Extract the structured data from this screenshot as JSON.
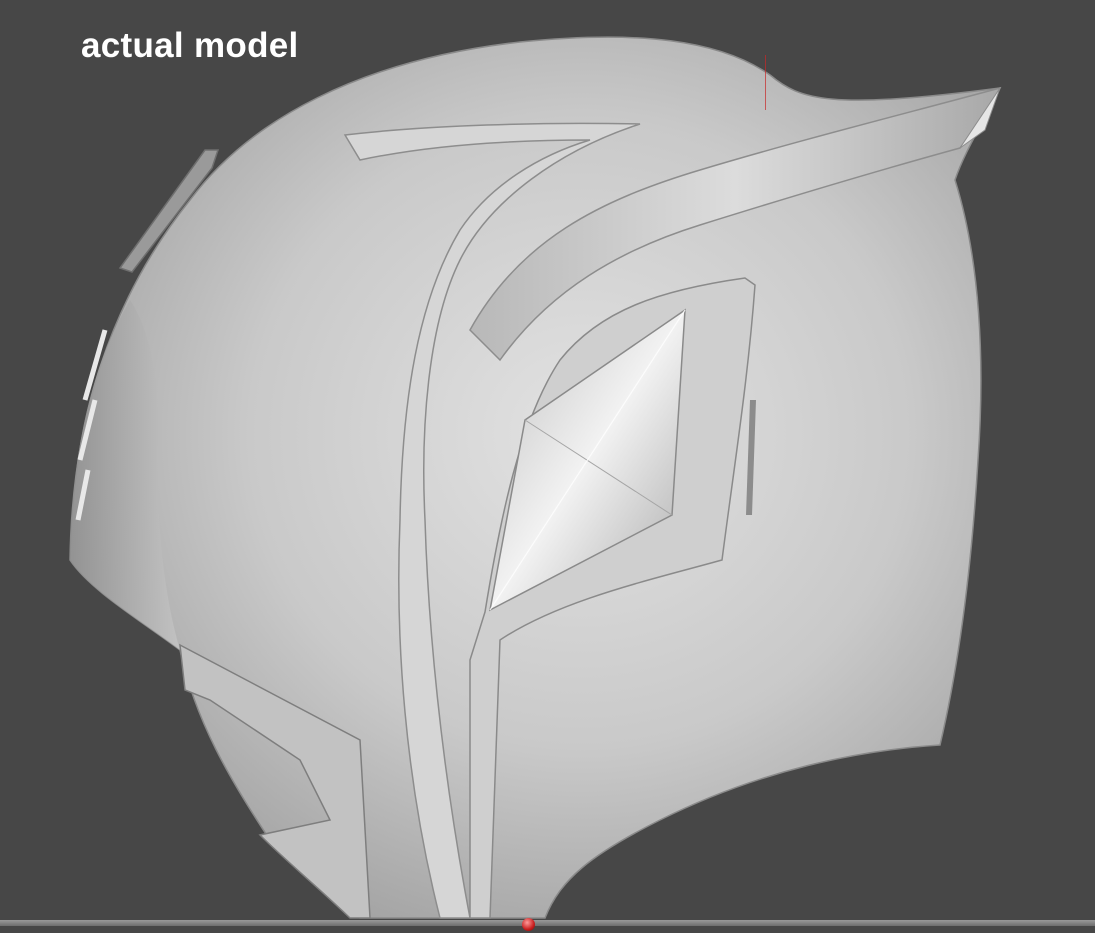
{
  "caption": "actual model",
  "colors": {
    "background": "#474747",
    "model_surface": "#c8c8c8",
    "caption_text": "#ffffff",
    "origin_marker": "#c81e1e"
  }
}
